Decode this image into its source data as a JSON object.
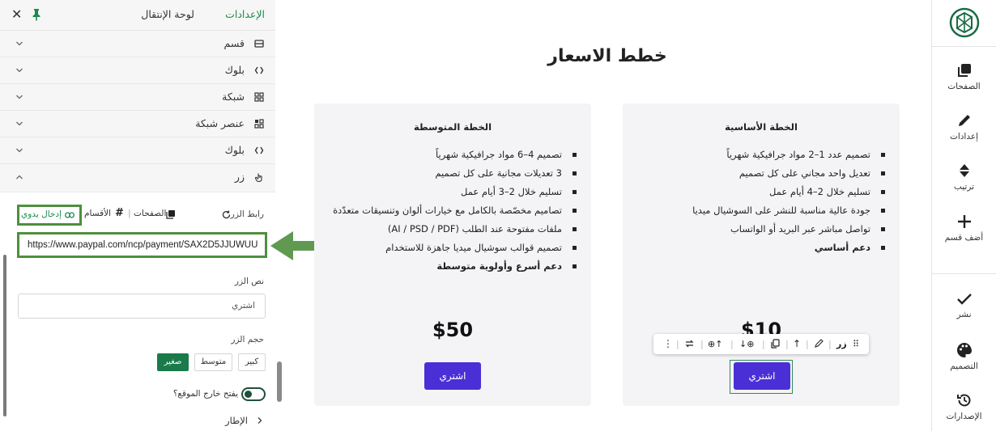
{
  "panel": {
    "tabs": {
      "settings": "الإعدادات",
      "navigation": "لوحة الإنتقال"
    },
    "sections": [
      {
        "label": "قسم",
        "icon": "section-icon"
      },
      {
        "label": "بلوك",
        "icon": "block-code-icon"
      },
      {
        "label": "شبكة",
        "icon": "grid-icon"
      },
      {
        "label": "عنصر شبكة",
        "icon": "grid-item-icon"
      },
      {
        "label": "بلوك",
        "icon": "block-code-icon"
      },
      {
        "label": "زر",
        "icon": "button-hand-icon"
      }
    ],
    "button": {
      "link_label": "رابط الزر",
      "link_options": {
        "pages": "الصفحات",
        "sections": "الأقسام",
        "manual": "إدخال يدوي"
      },
      "url_value": "https://www.paypal.com/ncp/payment/SAX2D5JJUWUU",
      "text_label": "نص الزر",
      "text_value": "اشتري",
      "size_label": "حجم الزر",
      "sizes": {
        "large": "كبير",
        "medium": "متوسط",
        "small": "صغير"
      },
      "selected_size": "صغير",
      "external_label": "يفتح خارج الموقع؟",
      "external_enabled": true,
      "frame_label": "الإطار"
    },
    "accent_color": "#1a8a4e",
    "highlight_color": "#4e8f3e"
  },
  "canvas": {
    "title": "خطط الاسعار",
    "plans": [
      {
        "name": "الخطة الأساسية",
        "features": [
          "تصميم عدد 1–2 مواد جرافيكية شهرياً",
          "تعديل واحد مجاني على كل تصميم",
          "تسليم خلال 2–4 أيام عمل",
          "جودة عالية مناسبة للنشر على السوشيال ميديا",
          "تواصل مباشر عبر البريد أو الواتساب",
          "دعم أساسي"
        ],
        "price": "$10",
        "button": "اشتري"
      },
      {
        "name": "الخطة المتوسطة",
        "features": [
          "تصميم 4–6 مواد جرافيكية شهرياً",
          "3 تعديلات مجانية على كل تصميم",
          "تسليم خلال 2–3 أيام عمل",
          "تصاميم مخصّصة بالكامل مع خيارات ألوان وتنسيقات متعدّدة",
          "ملفات مفتوحة عند الطلب (AI / PSD / PDF)",
          "تصميم قوالب سوشيال ميديا جاهزة للاستخدام",
          "دعم أسرع وأولوية متوسطة"
        ],
        "price": "$50",
        "button": "اشتري"
      }
    ],
    "toolbar": {
      "element_label": "زر"
    },
    "button_color": "#4b2fd6"
  },
  "rightnav": {
    "items": [
      {
        "label": "الصفحات",
        "icon": "pages-icon"
      },
      {
        "label": "إعدادات",
        "icon": "pencil-icon"
      },
      {
        "label": "ترتيب",
        "icon": "sort-icon"
      },
      {
        "label": "أضف قسم",
        "icon": "plus-icon"
      },
      {
        "label": "نشر",
        "icon": "check-icon"
      },
      {
        "label": "التصميم",
        "icon": "palette-icon"
      },
      {
        "label": "الإصدارات",
        "icon": "history-icon"
      }
    ]
  }
}
